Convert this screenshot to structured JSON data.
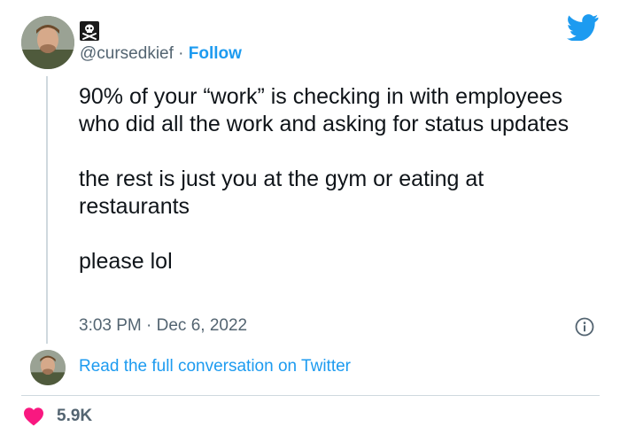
{
  "tweet": {
    "handle": "@cursedkief",
    "separator": "·",
    "follow_label": "Follow",
    "paragraphs": [
      "90% of your “work” is checking in with employees who did all the work and asking for status updates",
      "the rest is just you at the gym or eating at restaurants",
      "please lol"
    ],
    "timestamp": "3:03 PM · Dec 6, 2022",
    "read_full_label": "Read the full conversation on Twitter",
    "like_count": "5.9K"
  },
  "icons": {
    "brand": "twitter-bird-icon",
    "name_emoji": "skull-crossbones-icon",
    "info": "info-icon",
    "like": "heart-icon"
  },
  "colors": {
    "accent": "#1d9bf0",
    "like": "#f91880",
    "text": "#0f1419",
    "muted": "#536471",
    "divider": "#cfd9de"
  }
}
